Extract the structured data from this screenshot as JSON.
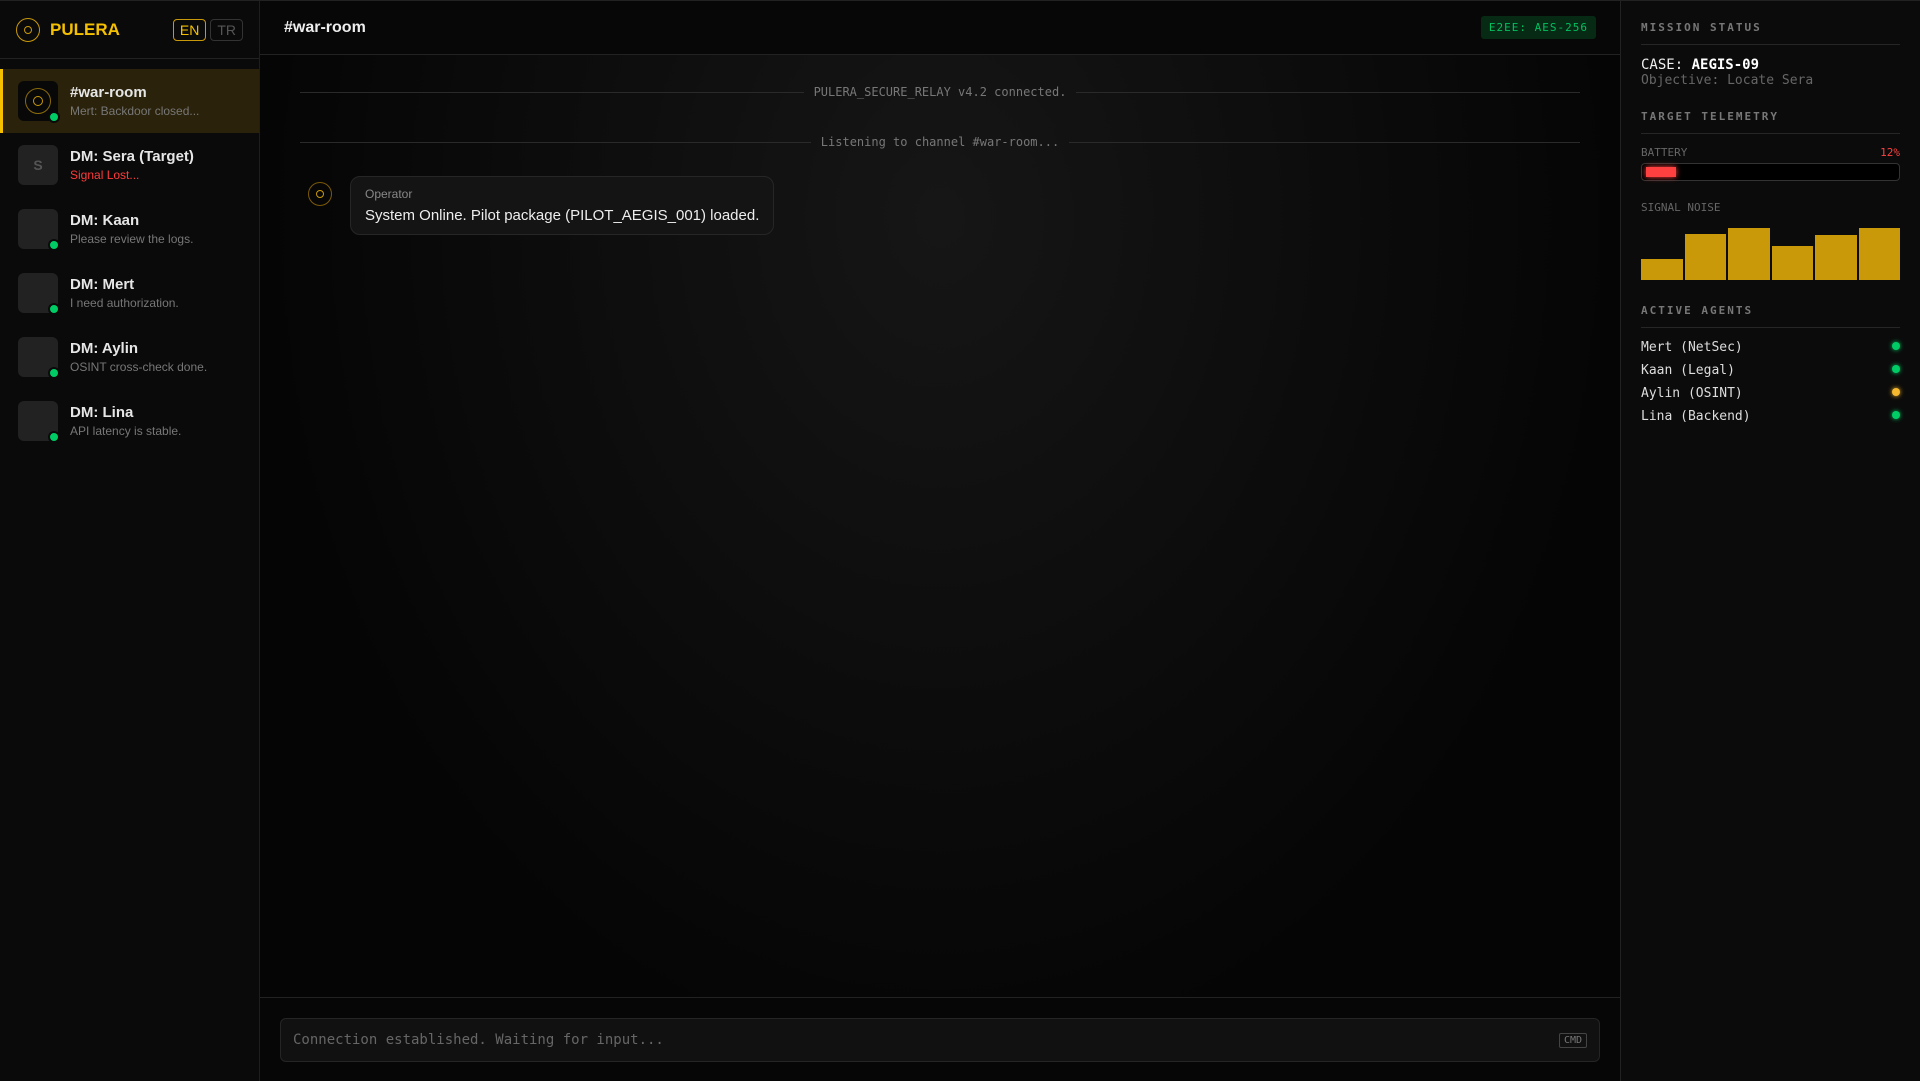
{
  "brand": {
    "name": "PULERA",
    "langs": [
      "EN",
      "TR"
    ],
    "active_lang": "EN"
  },
  "channels": [
    {
      "name": "#war-room",
      "preview": "Mert: Backdoor closed...",
      "online": true,
      "active": true
    },
    {
      "name": "DM: Sera (Target)",
      "preview": "Signal Lost...",
      "initial": "S",
      "online": false,
      "alert": true
    },
    {
      "name": "DM: Kaan",
      "preview": "Please review the logs.",
      "online": true
    },
    {
      "name": "DM: Mert",
      "preview": "I need authorization.",
      "online": true
    },
    {
      "name": "DM: Aylin",
      "preview": "OSINT cross-check done.",
      "online": true
    },
    {
      "name": "DM: Lina",
      "preview": "API latency is stable.",
      "online": true
    }
  ],
  "header": {
    "title": "#war-room",
    "badge": "E2EE: AES-256"
  },
  "system": [
    "PULERA_SECURE_RELAY v4.2 connected.",
    "Listening to channel #war-room..."
  ],
  "messages": [
    {
      "sender": "Operator",
      "text": "System Online. Pilot package (PILOT_AEGIS_001) loaded."
    }
  ],
  "input": {
    "placeholder": "Connection established. Waiting for input...",
    "hint": "CMD"
  },
  "mission": {
    "title": "MISSION STATUS",
    "case_label": "CASE:",
    "case_id": "AEGIS-09",
    "objective": "Objective: Locate Sera"
  },
  "telemetry": {
    "title": "TARGET TELEMETRY",
    "battery_label": "BATTERY",
    "battery_pct": "12%",
    "battery_value": 12,
    "noise_label": "SIGNAL NOISE",
    "noise_values": [
      40,
      89,
      100,
      66,
      87,
      100
    ]
  },
  "agents": {
    "title": "ACTIVE AGENTS",
    "list": [
      {
        "name": "Mert (NetSec)",
        "color": "#00cc66"
      },
      {
        "name": "Kaan (Legal)",
        "color": "#00cc66"
      },
      {
        "name": "Aylin (OSINT)",
        "color": "#f5b82e"
      },
      {
        "name": "Lina (Backend)",
        "color": "#00cc66"
      }
    ]
  }
}
